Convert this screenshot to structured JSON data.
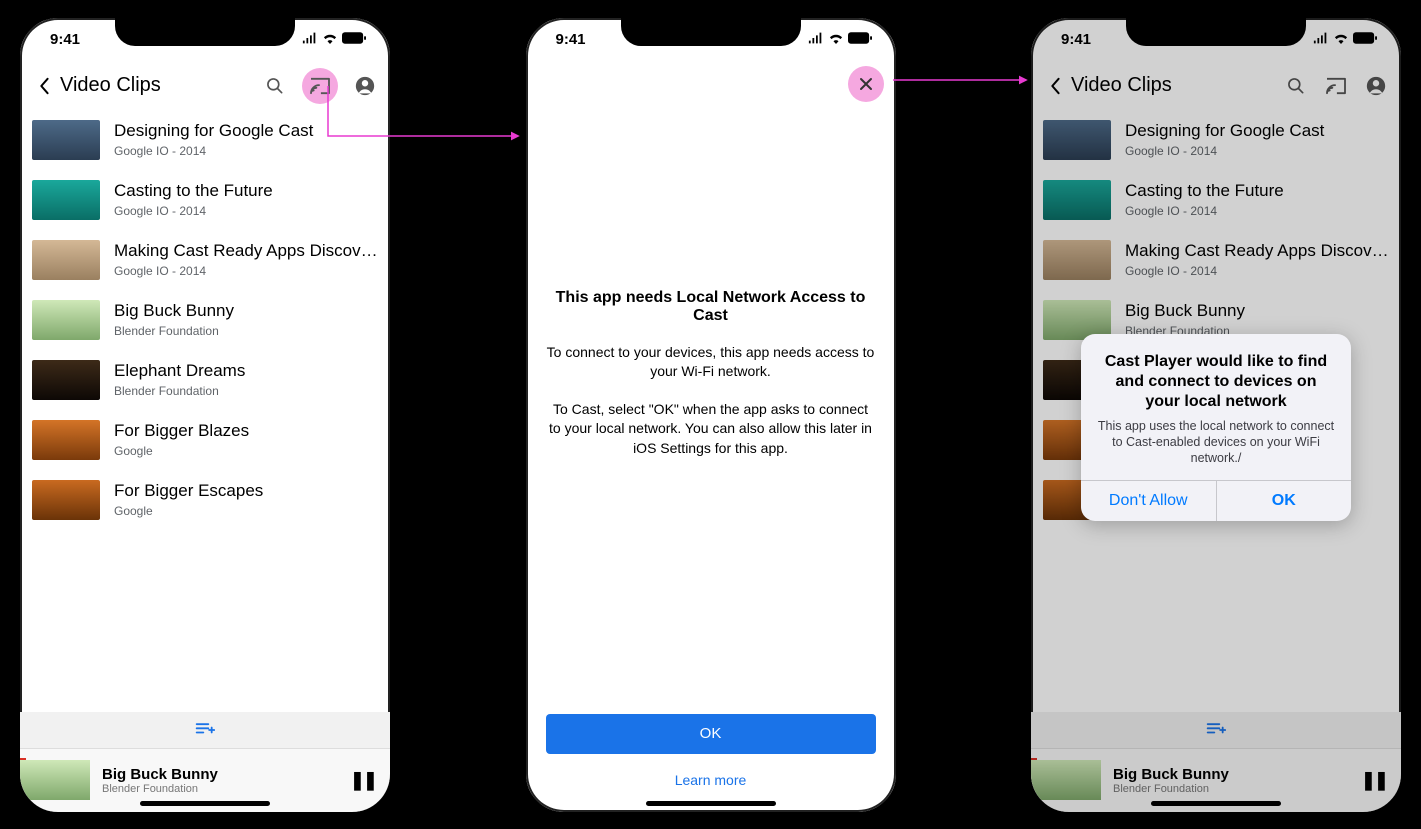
{
  "status": {
    "time": "9:41"
  },
  "header": {
    "title": "Video Clips"
  },
  "videos": [
    {
      "title": "Designing for Google Cast",
      "subtitle": "Google IO - 2014"
    },
    {
      "title": "Casting to the Future",
      "subtitle": "Google IO - 2014"
    },
    {
      "title": "Making Cast Ready Apps Discover...",
      "subtitle": "Google IO - 2014"
    },
    {
      "title": "Big Buck Bunny",
      "subtitle": "Blender Foundation"
    },
    {
      "title": "Elephant Dreams",
      "subtitle": "Blender Foundation"
    },
    {
      "title": "For Bigger Blazes",
      "subtitle": "Google"
    },
    {
      "title": "For Bigger Escapes",
      "subtitle": "Google"
    }
  ],
  "now_playing": {
    "title": "Big Buck Bunny",
    "subtitle": "Blender Foundation"
  },
  "interstitial": {
    "title": "This app needs Local Network Access to Cast",
    "body1": "To connect to your devices, this app needs access to your Wi-Fi network.",
    "body2": "To Cast, select \"OK\" when the app asks to connect to your local network. You can also allow this later in iOS Settings for this app.",
    "ok": "OK",
    "learn_more": "Learn more"
  },
  "alert": {
    "title": "Cast Player would like to find and connect to devices on your local network",
    "message": "This app uses the local network to connect to Cast-enabled devices on your WiFi network./",
    "dont_allow": "Don't Allow",
    "ok": "OK"
  }
}
